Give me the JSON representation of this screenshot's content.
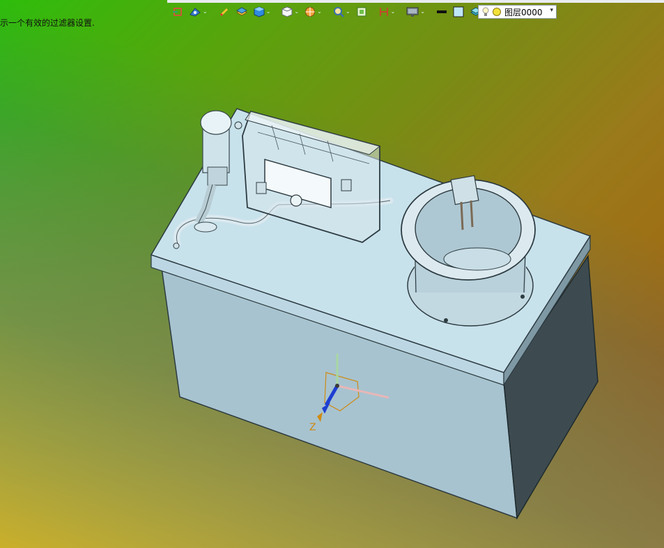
{
  "status": {
    "message": "示一个有效的过滤器设置."
  },
  "toolbar": {
    "items": [
      {
        "icon": "view-orientation-icon",
        "has_dropdown": false
      },
      {
        "icon": "saved-views-icon",
        "has_dropdown": true
      },
      {
        "icon": "sketch-pen-icon",
        "has_dropdown": false
      },
      {
        "icon": "layer-stack-icon",
        "has_dropdown": false
      },
      {
        "icon": "shaded-cube-icon",
        "has_dropdown": true
      },
      {
        "icon": "wireframe-cube-icon",
        "has_dropdown": true
      },
      {
        "icon": "section-view-icon",
        "has_dropdown": true
      },
      {
        "icon": "zoom-icon",
        "has_dropdown": true
      },
      {
        "icon": "fit-view-icon",
        "has_dropdown": false
      },
      {
        "icon": "dimension-icon",
        "has_dropdown": true
      },
      {
        "icon": "display-monitor-icon",
        "has_dropdown": true
      },
      {
        "icon": "line-color-icon",
        "has_dropdown": false
      },
      {
        "icon": "fill-color-icon",
        "has_dropdown": false
      },
      {
        "icon": "surface-color-icon",
        "has_dropdown": true
      }
    ],
    "layer": {
      "value": "图层0000",
      "icons": [
        "light-bulb-icon",
        "layer-state-icon"
      ]
    }
  },
  "colors": {
    "bg_top_left": "#2ebd0b",
    "bg_top_right": "#a65a0a",
    "bg_bottom_left": "#e6b914",
    "bg_bottom_right": "#2c78b6",
    "model_face": "#c9e2ec",
    "model_side": "#a4c2cf",
    "model_dark": "#3b4a4f",
    "axis_x": "#d23a3a",
    "axis_y": "#26a52f",
    "axis_z": "#1d3fd2",
    "axis_label": "#d08a12"
  },
  "axis": {
    "label": "Z"
  }
}
